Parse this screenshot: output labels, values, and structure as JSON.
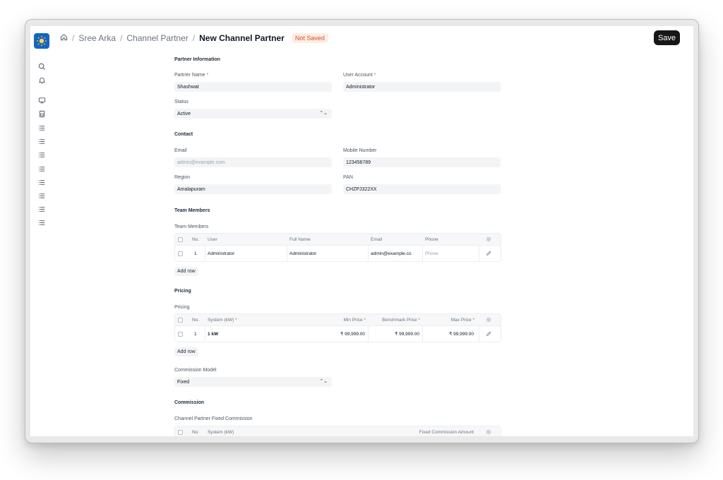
{
  "breadcrumb": {
    "items": [
      "Sree Arka",
      "Channel Partner"
    ],
    "separator": "/",
    "current": "New Channel Partner",
    "status_badge": "Not Saved"
  },
  "toolbar": {
    "save_label": "Save"
  },
  "sidebar": {
    "icons": [
      "search-icon",
      "bell-icon",
      "monitor-icon",
      "document-icon",
      "list-icon",
      "list-icon",
      "list-icon",
      "list-icon",
      "list-icon",
      "list-icon",
      "list-icon",
      "list-icon"
    ]
  },
  "partner_information": {
    "title": "Partner Information",
    "partner_name": {
      "label": "Partner Name",
      "value": "Shashwat"
    },
    "user_account": {
      "label": "User Account",
      "value": "Administrator"
    },
    "status": {
      "label": "Status",
      "value": "Active"
    }
  },
  "contact": {
    "title": "Contact",
    "email": {
      "label": "Email",
      "placeholder": "admin@example.com"
    },
    "mobile": {
      "label": "Mobile Number",
      "value": "123456789"
    },
    "region": {
      "label": "Region",
      "value": "Amalapuram"
    },
    "pan": {
      "label": "PAN",
      "value": "CHZPJ322XX"
    }
  },
  "team_members": {
    "title": "Team Members",
    "table_label": "Team Members",
    "columns": [
      "No.",
      "User",
      "Full Name",
      "Email",
      "Phone"
    ],
    "rows": [
      {
        "no": "1",
        "user": "Administrator",
        "full_name": "Administrator",
        "email": "admin@example.co",
        "phone": "Phone"
      }
    ],
    "add_row": "Add row"
  },
  "pricing": {
    "title": "Pricing",
    "table_label": "Pricing",
    "columns": [
      "No.",
      "System (kW)",
      "Min Price",
      "Benchmark Price",
      "Max Price"
    ],
    "rows": [
      {
        "no": "1",
        "system": "1 kW",
        "min": "₹ 99,999.00",
        "benchmark": "₹ 99,999.00",
        "max": "₹ 99,999.00"
      }
    ],
    "add_row": "Add row",
    "commission_model": {
      "label": "Commission Model",
      "value": "Fixed"
    }
  },
  "commission": {
    "title": "Commission",
    "table_label": "Channel Partner Fixed Commission",
    "columns": [
      "No.",
      "System (kW)",
      "Fixed Commission Amount"
    ]
  },
  "colors": {
    "accent": "#171717",
    "badge_bg": "#fdeee4",
    "badge_text": "#d1552a",
    "logo_bg": "#1565c0",
    "required": "#e25656"
  }
}
